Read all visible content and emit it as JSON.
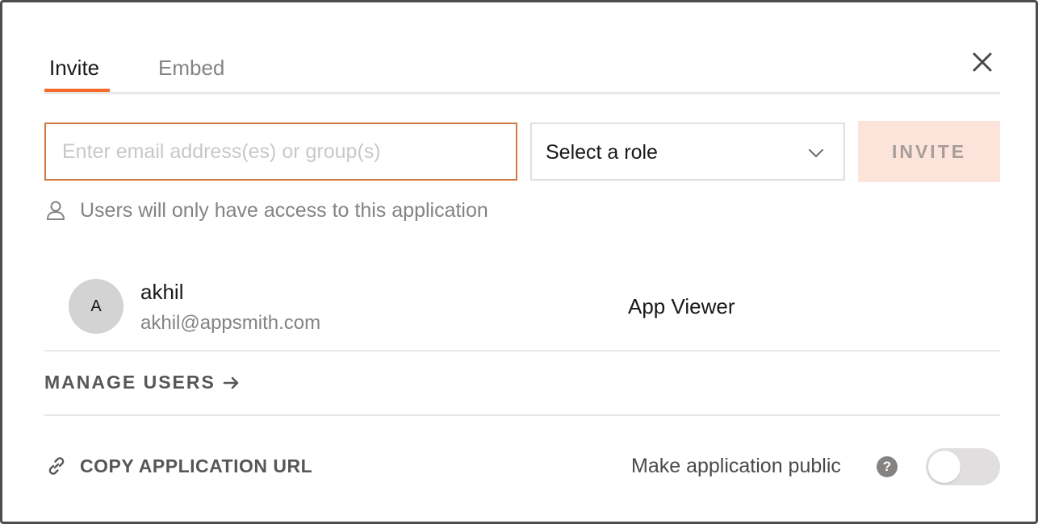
{
  "tabs": [
    {
      "label": "Invite",
      "active": true
    },
    {
      "label": "Embed",
      "active": false
    }
  ],
  "invite": {
    "email_placeholder": "Enter email address(es) or group(s)",
    "email_value": "",
    "role_placeholder": "Select a role",
    "invite_label": "INVITE"
  },
  "access_note": "Users will only have access to this application",
  "members": [
    {
      "initial": "A",
      "name": "akhil",
      "email": "akhil@appsmith.com",
      "role": "App Viewer"
    }
  ],
  "manage_users_label": "MANAGE USERS",
  "copy_url_label": "COPY APPLICATION URL",
  "public": {
    "label": "Make application public",
    "enabled": false
  },
  "colors": {
    "accent": "#f86a2b",
    "input_border": "#d0783e",
    "invite_bg": "#fde4db",
    "muted_text": "#858282"
  },
  "icons": {
    "close": "close-icon",
    "chevron": "chevron-down-icon",
    "user": "user-icon",
    "arrow": "arrow-right-icon",
    "link": "link-icon",
    "help": "help-icon"
  }
}
